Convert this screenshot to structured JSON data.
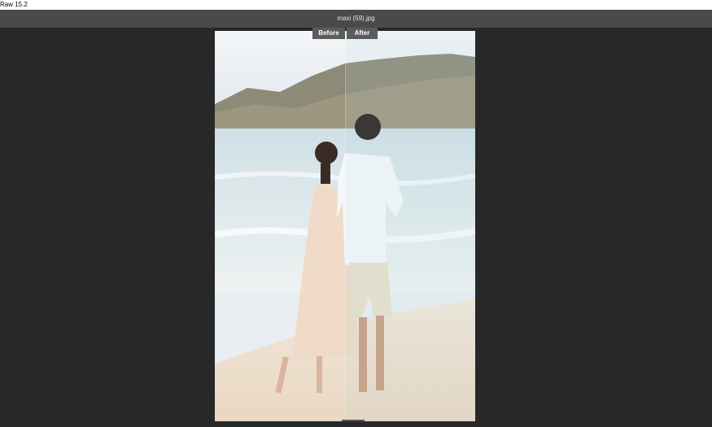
{
  "app": {
    "title": "Raw 15.2"
  },
  "file": {
    "name": "maxi (59).jpg"
  },
  "compare": {
    "before_label": "Before",
    "after_label": "After"
  },
  "colors": {
    "background": "#282828",
    "filebar": "#4a4a4a",
    "button": "#5c5c5c"
  }
}
